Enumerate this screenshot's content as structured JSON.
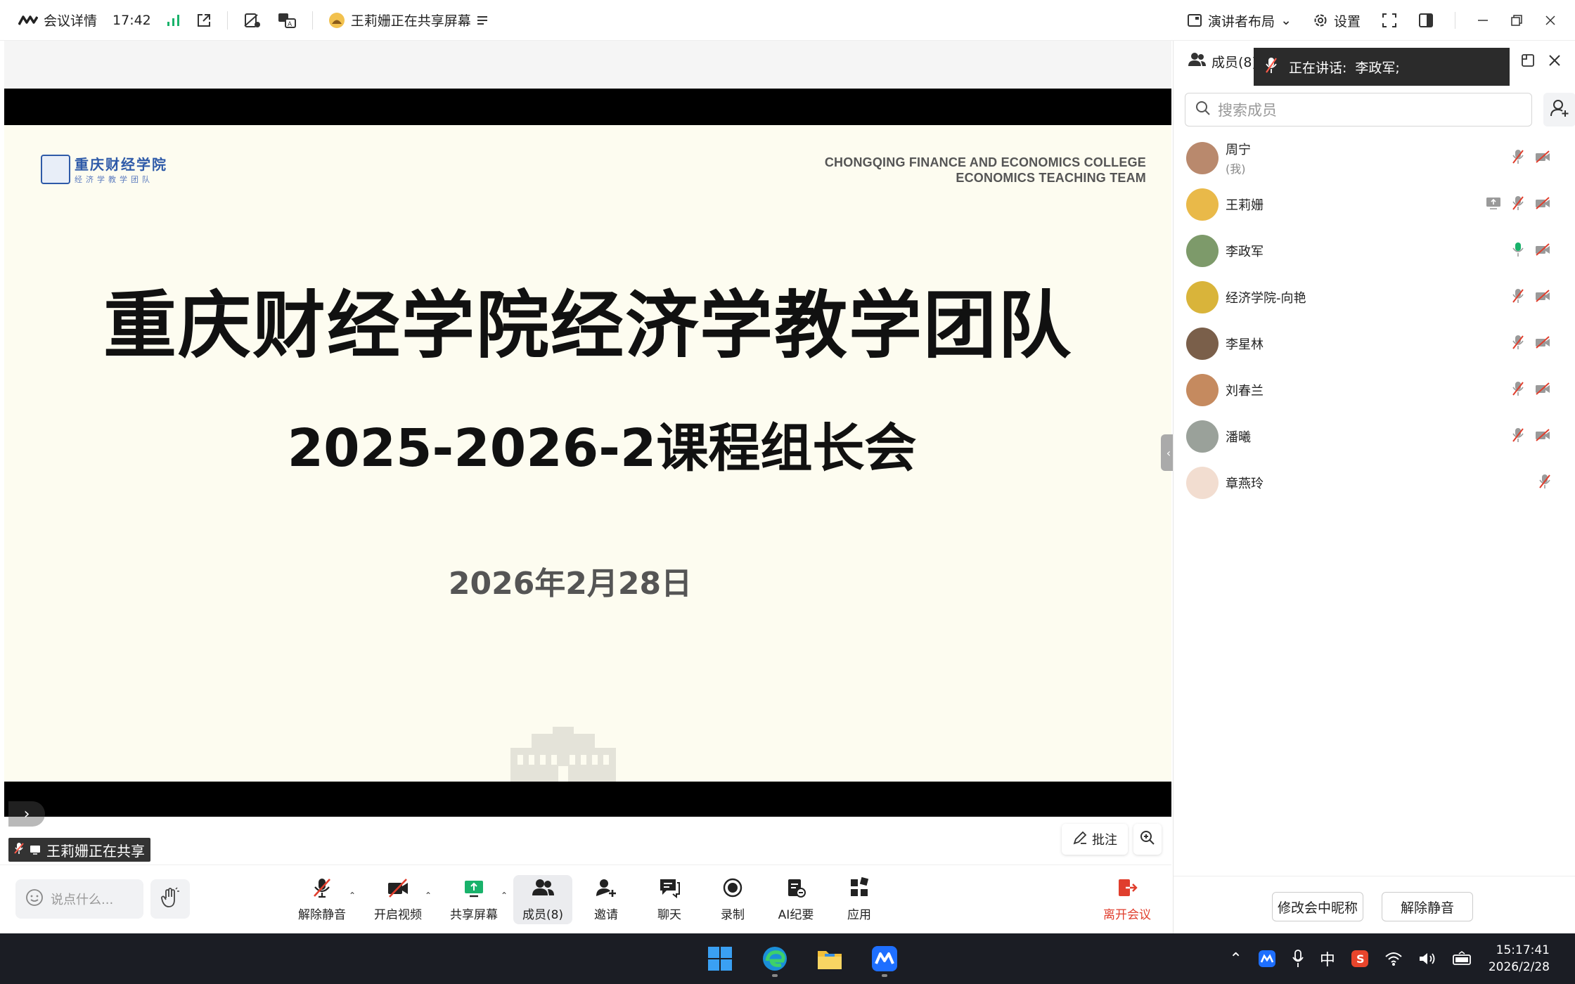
{
  "topbar": {
    "meeting_details": "会议详情",
    "time": "17:42",
    "sharing_status": "王莉姗正在共享屏幕",
    "layout": "演讲者布局",
    "settings": "设置"
  },
  "slide": {
    "college_en_line1": "CHONGQING FINANCE AND ECONOMICS COLLEGE",
    "college_en_line2": "ECONOMICS TEACHING TEAM",
    "logo_line1": "重庆财经学院",
    "logo_line2": "经济学教学团队",
    "title": "重庆财经学院经济学教学团队",
    "subtitle": "2025-2026-2课程组长会",
    "date": "2026年2月28日"
  },
  "stage": {
    "share_label": "王莉姗正在共享",
    "annotate": "批注"
  },
  "toolbar": {
    "chat_placeholder": "说点什么...",
    "unmute": "解除静音",
    "start_video": "开启视频",
    "share_screen": "共享屏幕",
    "members": "成员(8)",
    "invite": "邀请",
    "chat": "聊天",
    "record": "录制",
    "ai_minutes": "AI纪要",
    "apps": "应用",
    "leave": "离开会议"
  },
  "panel": {
    "tab": "成员(8)",
    "speaking_label": "正在讲话:",
    "speaking_name": "李政军;",
    "search_placeholder": "搜索成员",
    "members": [
      {
        "name": "周宁",
        "note": "(我)"
      },
      {
        "name": "王莉姗",
        "note": ""
      },
      {
        "name": "李政军",
        "note": ""
      },
      {
        "name": "经济学院-向艳",
        "note": ""
      },
      {
        "name": "李星林",
        "note": ""
      },
      {
        "name": "刘春兰",
        "note": ""
      },
      {
        "name": "潘曦",
        "note": ""
      },
      {
        "name": "章燕玲",
        "note": ""
      }
    ],
    "rename": "修改会中昵称",
    "unmute": "解除静音"
  },
  "taskbar": {
    "ime": "中",
    "time": "15:17:41",
    "date": "2026/2/28"
  },
  "colors": {
    "accent": "#1e6fff",
    "danger": "#e03e2d",
    "green": "#19b26b"
  }
}
